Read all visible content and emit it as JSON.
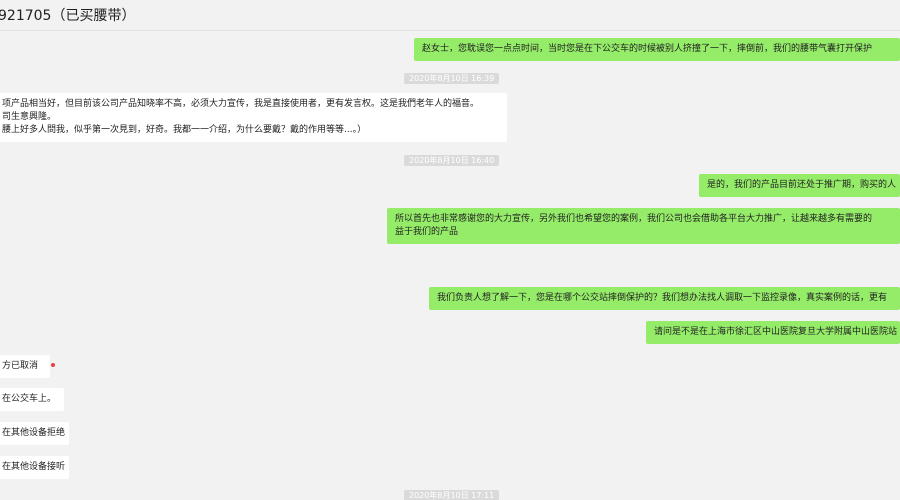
{
  "header": {
    "title": "921705（已买腰带）"
  },
  "messages": [
    {
      "type": "out",
      "lines": [
        "赵女士，您耽误您一点点时间，当时您是在下公交车的时候被别人挤撞了一下，摔倒前，我们的腰带气囊打开保护"
      ]
    },
    {
      "type": "time",
      "text": "2020年8月10日 16:39"
    },
    {
      "type": "in",
      "lines": [
        "项产品相当好，但目前该公司产品知晓率不高，必须大力宣传，我是直接使用者，更有发言权。这是我們老年人的福音。",
        "司生意興隆。",
        "腰上好多人問我，似乎第一次見到，好奇。我都一一介绍，为什么要戴？戴的作用等等...。）"
      ]
    },
    {
      "type": "time",
      "text": "2020年8月10日 16:40"
    },
    {
      "type": "out",
      "lines": [
        "是的，我们的产品目前还处于推广期，购买的人"
      ]
    },
    {
      "type": "out",
      "lines": [
        "所以首先也非常感谢您的大力宣传，另外我们也希望您的案例，我们公司也会借助各平台大力推广，让越来越多有需要的",
        "益于我们的产品"
      ]
    },
    {
      "type": "out",
      "lines": [
        "我们负责人想了解一下，您是在哪个公交站摔倒保护的？我们想办法找人调取一下监控录像，真实案例的话，更有"
      ]
    },
    {
      "type": "out",
      "lines": [
        "请问是不是在上海市徐汇区中山医院复旦大学附属中山医院站"
      ]
    },
    {
      "type": "in",
      "lines": [
        "方已取消"
      ]
    },
    {
      "type": "in",
      "lines": [
        "在公交车上。"
      ]
    },
    {
      "type": "in",
      "lines": [
        "在其他设备拒绝"
      ]
    },
    {
      "type": "in",
      "lines": [
        "在其他设备接听"
      ]
    },
    {
      "type": "time",
      "text": "2020年8月10日 17:11"
    }
  ]
}
